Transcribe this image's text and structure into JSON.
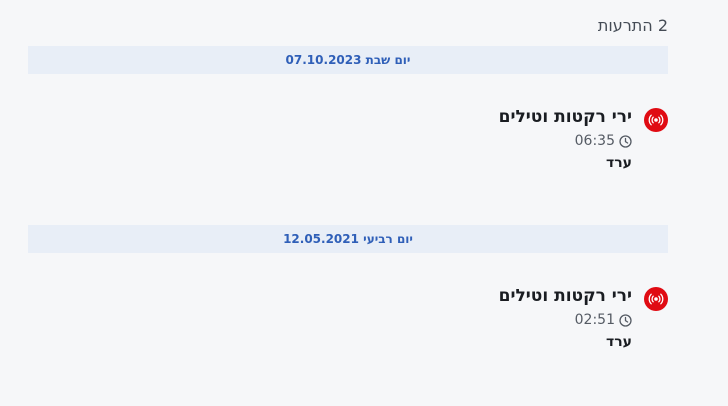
{
  "header": {
    "alerts_count_label": "2 התרעות"
  },
  "groups": [
    {
      "date_label": "יום שבת 07.10.2023",
      "alert": {
        "title": "ירי רקטות וטילים",
        "time": "06:35",
        "location": "ערד",
        "icon": "siren-icon"
      }
    },
    {
      "date_label": "יום רביעי 12.05.2021",
      "alert": {
        "title": "ירי רקטות וטילים",
        "time": "02:51",
        "location": "ערד",
        "icon": "siren-icon"
      }
    }
  ],
  "colors": {
    "alert_red": "#e00b13",
    "date_blue": "#2f5fb8",
    "date_bg": "#e8eef7",
    "page_bg": "#f6f7f9"
  }
}
